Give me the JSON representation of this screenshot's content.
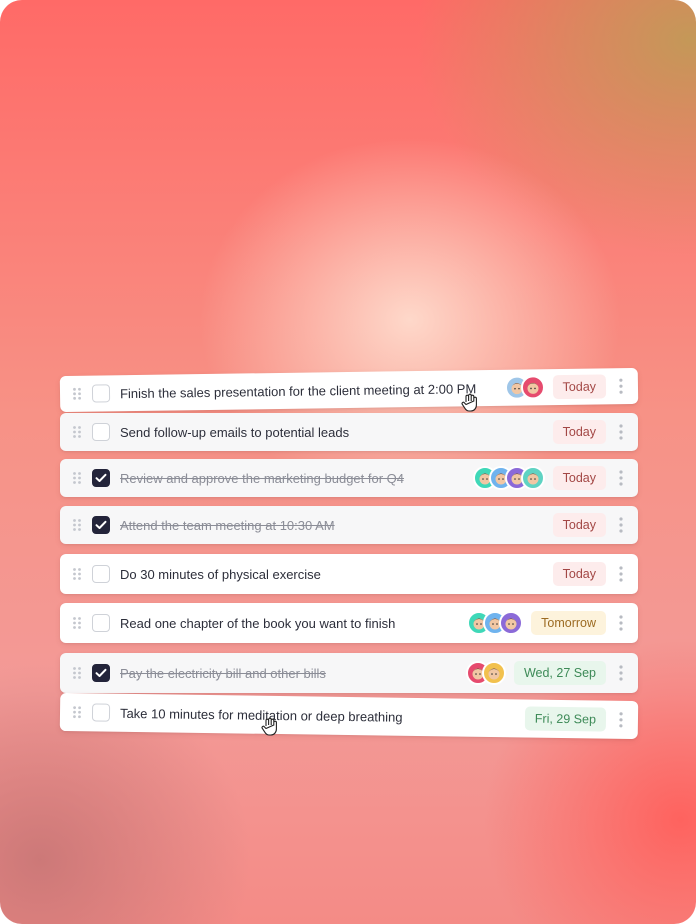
{
  "tasks": [
    {
      "title": "Finish the sales presentation for the client meeting at 2:00 PM",
      "checked": false,
      "due": "Today",
      "tone": "red",
      "avatars": [
        "#9fc6e8",
        "#e64b6e"
      ]
    },
    {
      "title": "Send follow-up emails to potential leads",
      "checked": false,
      "due": "Today",
      "tone": "red",
      "avatars": []
    },
    {
      "title": "Review and approve the marketing budget for Q4",
      "checked": true,
      "due": "Today",
      "tone": "red",
      "avatars": [
        "#3fd8b8",
        "#6fb3ee",
        "#8b6ad8",
        "#5fd3c3"
      ]
    },
    {
      "title": "Attend the team meeting at 10:30 AM",
      "checked": true,
      "due": "Today",
      "tone": "red",
      "avatars": []
    },
    {
      "title": "Do 30 minutes of physical exercise",
      "checked": false,
      "due": "Today",
      "tone": "red",
      "avatars": []
    },
    {
      "title": "Read one chapter of the book you want to finish",
      "checked": false,
      "due": "Tomorrow",
      "tone": "amber",
      "avatars": [
        "#3fd8b8",
        "#6fb3ee",
        "#8b6ad8"
      ]
    },
    {
      "title": "Pay the electricity bill and other bills",
      "checked": true,
      "due": "Wed, 27 Sep",
      "tone": "green",
      "avatars": [
        "#e64b6e",
        "#f2c14e"
      ]
    },
    {
      "title": "Take 10 minutes for meditation or deep breathing",
      "checked": false,
      "due": "Fri, 29 Sep",
      "tone": "green",
      "avatars": []
    }
  ],
  "icons": {
    "grip": "drag-handle-icon",
    "more": "more-vertical-icon",
    "check": "checkmark-icon",
    "cursor": "hand-cursor-icon"
  }
}
